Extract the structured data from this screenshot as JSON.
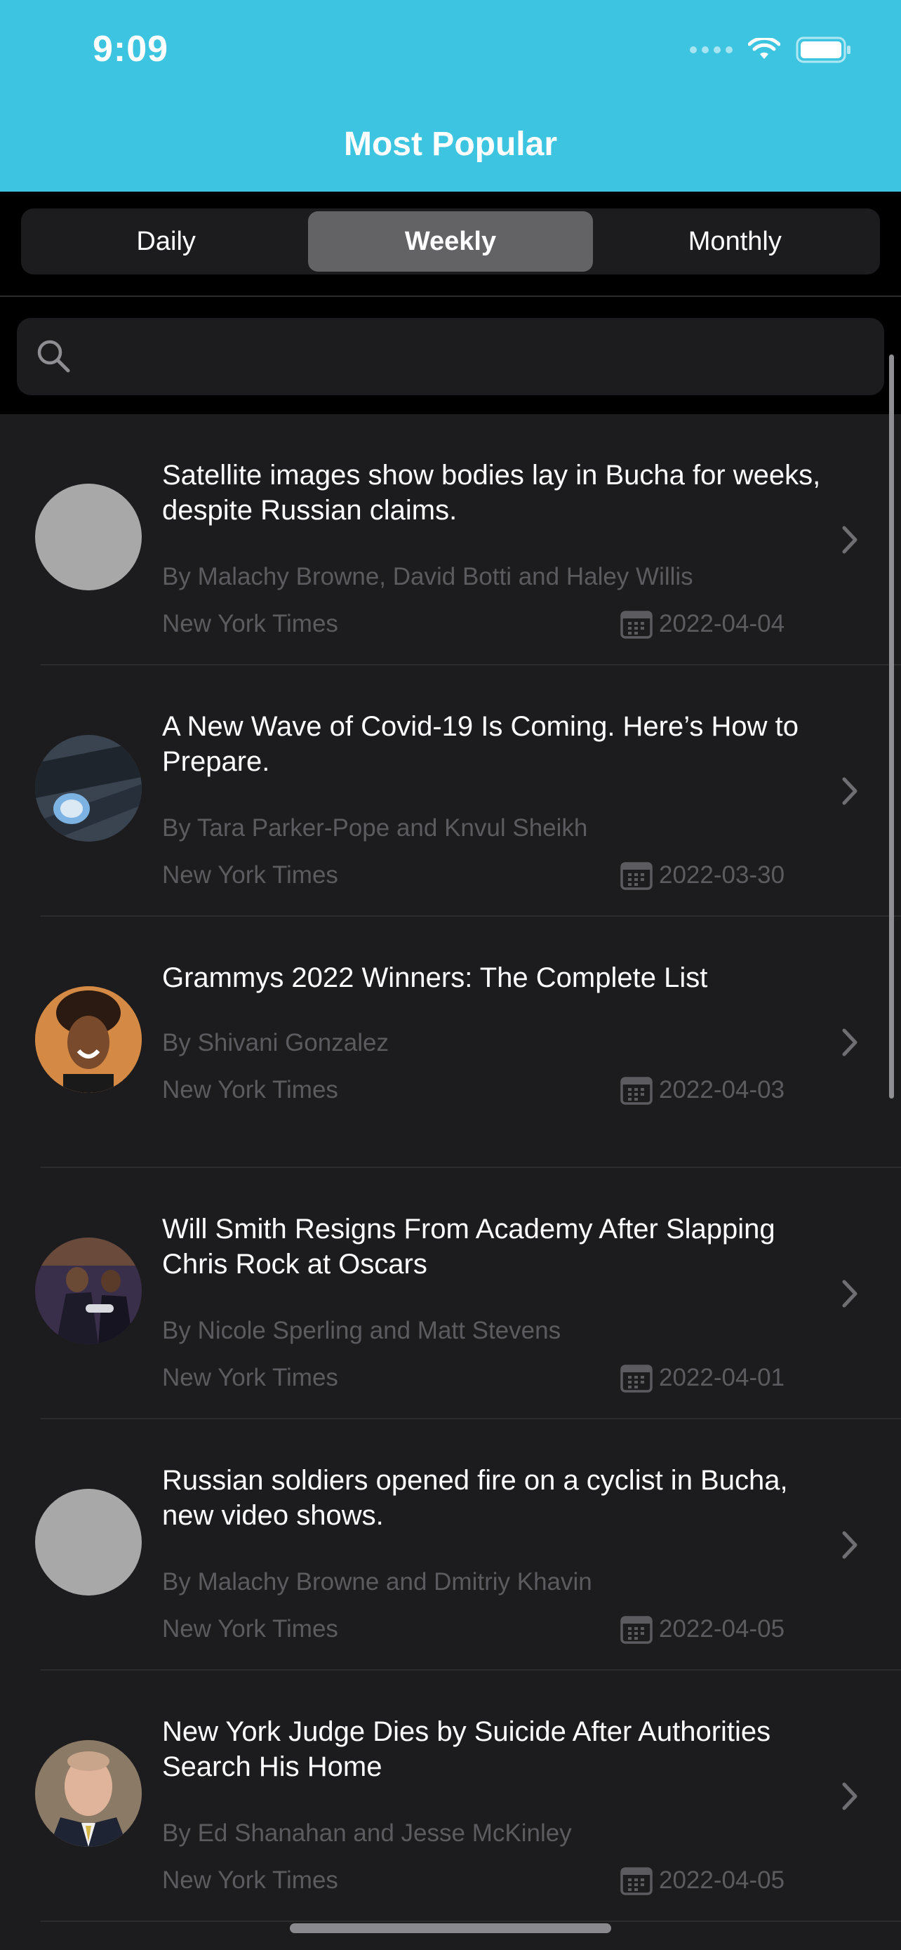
{
  "status": {
    "time": "9:09"
  },
  "nav": {
    "title": "Most Popular"
  },
  "segments": [
    {
      "label": "Daily",
      "selected": false
    },
    {
      "label": "Weekly",
      "selected": true
    },
    {
      "label": "Monthly",
      "selected": false
    }
  ],
  "search": {
    "value": "",
    "placeholder": ""
  },
  "articles": [
    {
      "title": "Satellite images show bodies lay in Bucha for weeks, despite Russian claims.",
      "byline": "By Malachy Browne, David Botti and Haley Willis",
      "source": "New York Times",
      "date": "2022-04-04",
      "thumbnail": "placeholder"
    },
    {
      "title": "A New Wave of Covid-19 Is Coming. Here’s How to Prepare.",
      "byline": "By Tara Parker-Pope and Knvul Sheikh",
      "source": "New York Times",
      "date": "2022-03-30",
      "thumbnail": "covid-photo"
    },
    {
      "title": "Grammys 2022 Winners: The Complete List",
      "byline": "By Shivani Gonzalez",
      "source": "New York Times",
      "date": "2022-04-03",
      "thumbnail": "grammys-photo"
    },
    {
      "title": "Will Smith Resigns From Academy After Slapping Chris Rock at Oscars",
      "byline": "By Nicole Sperling and Matt Stevens",
      "source": "New York Times",
      "date": "2022-04-01",
      "thumbnail": "oscars-photo"
    },
    {
      "title": "Russian soldiers opened fire on a cyclist in Bucha, new video shows.",
      "byline": "By Malachy Browne and Dmitriy Khavin",
      "source": "New York Times",
      "date": "2022-04-05",
      "thumbnail": "placeholder"
    },
    {
      "title": "New York Judge Dies by Suicide After Authorities Search His Home",
      "byline": "By Ed Shanahan and Jesse McKinley",
      "source": "New York Times",
      "date": "2022-04-05",
      "thumbnail": "judge-photo"
    }
  ],
  "colors": {
    "header": "#3cc4e0",
    "background": "#1c1c1e",
    "secondary_text": "#5b5b60",
    "segment_active": "#636366"
  },
  "icons": {
    "search": "search-icon",
    "calendar": "calendar-icon",
    "chevron": "chevron-right-icon",
    "wifi": "wifi-icon",
    "battery": "battery-icon"
  }
}
